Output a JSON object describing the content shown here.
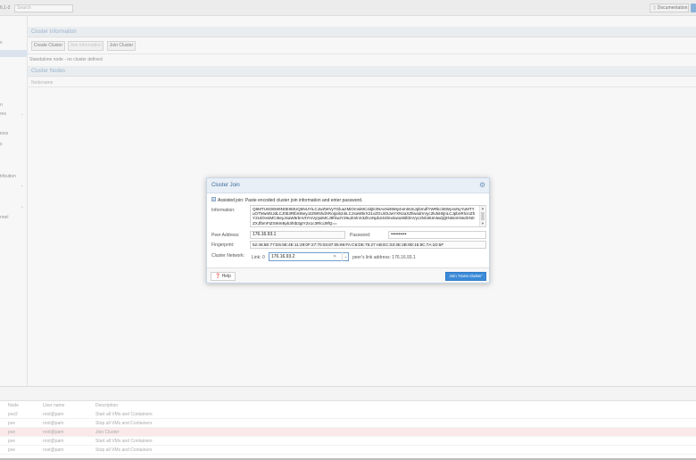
{
  "topbar": {
    "version": "6.1-2",
    "search_placeholder": "Search",
    "documentation_label": "Documentation",
    "documentation_icon": "book-icon"
  },
  "left_tree": {
    "items": [
      "s",
      "",
      "n",
      "res",
      "",
      "ions",
      "s",
      "",
      "tribution",
      "",
      "",
      "nnel"
    ]
  },
  "panel": {
    "cluster_info_title": "Cluster Information",
    "buttons": {
      "create": "Create Cluster",
      "join_info": "Join Information",
      "join": "Join Cluster"
    },
    "standalone_text": "Standalone node - no cluster defined",
    "cluster_nodes_title": "Cluster Nodes",
    "nodename_header": "Nodename"
  },
  "dialog": {
    "title": "Cluster Join",
    "assisted_label": "Assisted join: Paste encoded cluster join information and enter password.",
    "information_label": "Information:",
    "information_value": "Q6MTU6OEM6N0E6MUQ6NUYiLCJwZWVyTGluazMiOmsiMC4iIjE3NAxNi45My4xIn0sInJpbmdfYWRkciI6Wy4xNyYuMTYuOTMuMSJdLCJ0b3RlbSI6eyJzZWNhdXRoIjoib24iLCJsaW5rX21vZGUiOiJwYXNzaXZlIiwidmVyc2lvbiI6IjIiLCJpbnRlcmZhY2UiOnsiMCI6eyJsaW5rbnVtYmVyIjoiMCJ9fSwiY29uZmlnX3ZlcnNpb24iOiIxIiwiaXBfdmVyc2lvbiI6ImlwdjQtNiIsImNsdXN0ZXJfbmFtZSI6InByb3htb3gtY2x1c3RlciJ9fQ==",
    "peer_address_label": "Peer Address:",
    "peer_address_value": "176.16.93.1",
    "password_label": "Password:",
    "password_value": "••••••••••",
    "fingerprint_label": "Fingerprint:",
    "fingerprint_value": "52:46:5E:77:D5:5E:4E:11:29:0F:27:70:03:87:05:69:FA:C6:DE:75:27:AB:EC:03:3E:2B:9D:15:8C:7A:1D:5F",
    "cluster_network_label": "Cluster Network:",
    "link_label": "Link:",
    "link_number": "0",
    "link_value": "176.16.93.2",
    "peer_link_text": "peer's link address: 176.16.93.1",
    "help_label": "Help",
    "join_button_label": "Join 'Hans-cluster'"
  },
  "tasks": {
    "headers": {
      "node": "Node",
      "user": "User name",
      "description": "Description"
    },
    "rows": [
      {
        "node": "pve2",
        "user": "root@pam",
        "description": "Start all VMs and Containers",
        "error": false
      },
      {
        "node": "pve",
        "user": "root@pam",
        "description": "Stop all VMs and Containers",
        "error": false
      },
      {
        "node": "pve",
        "user": "root@pam",
        "description": "Join Cluster",
        "error": true
      },
      {
        "node": "pve",
        "user": "root@pam",
        "description": "Start all VMs and Containers",
        "error": false
      },
      {
        "node": "pve",
        "user": "root@pam",
        "description": "Stop all VMs and Containers",
        "error": false
      }
    ]
  },
  "colors": {
    "accent": "#3c8ad8",
    "error_row": "#fbe9ea",
    "selected": "#e3ecf6"
  }
}
